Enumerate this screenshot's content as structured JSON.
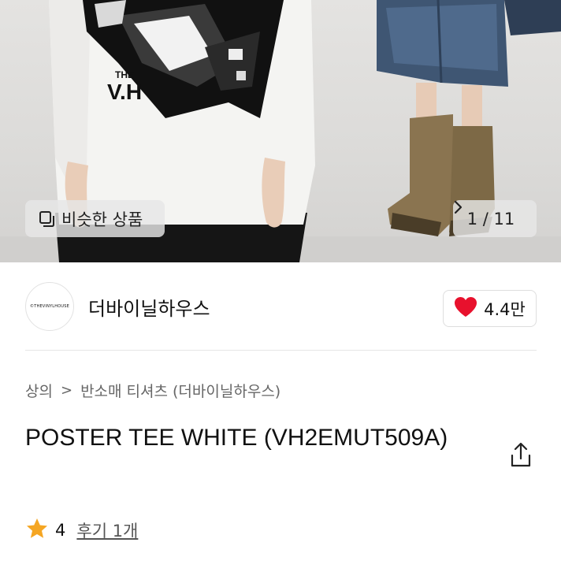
{
  "gallery": {
    "similar_label": "비슷한 상품",
    "counter": "1 / 11",
    "shirt_print_small": "THE",
    "shirt_print_big": "V.H"
  },
  "shop": {
    "logo_text": "©THEVINYLHOUSE",
    "name": "더바이닐하우스",
    "like_count": "4.4만"
  },
  "breadcrumb": {
    "items": [
      "상의",
      "반소매 티셔츠 (더바이닐하우스)"
    ],
    "separator": ">"
  },
  "product": {
    "title": "POSTER TEE WHITE (VH2EMUT509A)"
  },
  "rating": {
    "value": "4",
    "review_label": "후기 1개"
  },
  "colors": {
    "heart": "#e8112d",
    "star": "#f5a623",
    "text_primary": "#111111",
    "text_secondary": "#666666"
  },
  "icons": {
    "similar": "similar-products-icon",
    "chevron": "chevron-right-icon",
    "heart": "heart-icon",
    "share": "share-icon",
    "star": "star-icon"
  }
}
